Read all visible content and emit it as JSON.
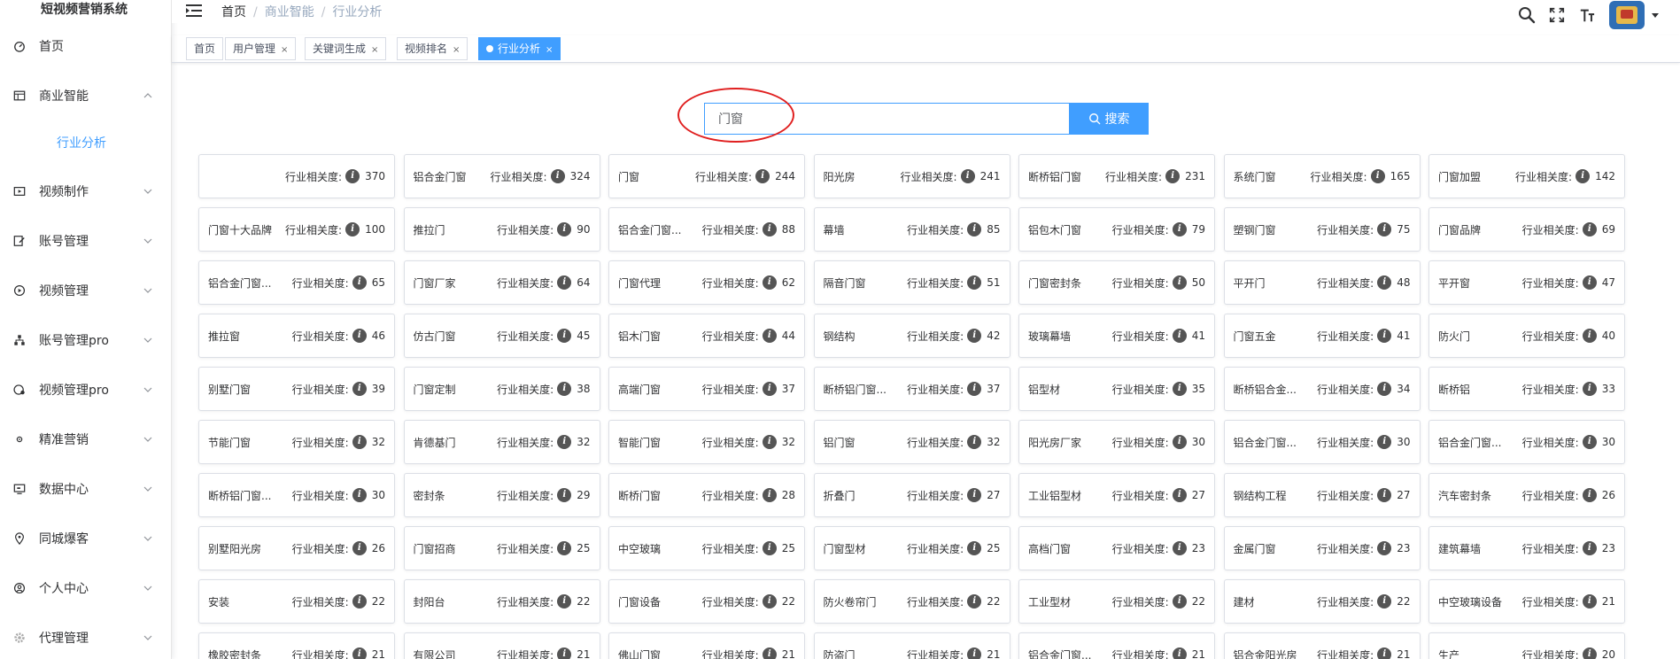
{
  "app": {
    "title": "短视频营销系统"
  },
  "sidebar": {
    "items": [
      {
        "label": "首页",
        "icon": "dashboard-icon",
        "expandable": false
      },
      {
        "label": "商业智能",
        "icon": "table-icon",
        "expandable": true,
        "expanded": true
      },
      {
        "label": "视频制作",
        "icon": "video-icon",
        "expandable": true
      },
      {
        "label": "账号管理",
        "icon": "edit-icon",
        "expandable": true
      },
      {
        "label": "视频管理",
        "icon": "play-icon",
        "expandable": true
      },
      {
        "label": "账号管理pro",
        "icon": "tree-icon",
        "expandable": true
      },
      {
        "label": "视频管理pro",
        "icon": "guide-icon",
        "expandable": true
      },
      {
        "label": "精准营销",
        "icon": "target-icon",
        "expandable": true
      },
      {
        "label": "数据中心",
        "icon": "monitor-icon",
        "expandable": true
      },
      {
        "label": "同城爆客",
        "icon": "location-icon",
        "expandable": true
      },
      {
        "label": "个人中心",
        "icon": "user-icon",
        "expandable": true
      },
      {
        "label": "代理管理",
        "icon": "settings-icon",
        "expandable": true
      }
    ],
    "submenu": {
      "label": "行业分析"
    }
  },
  "breadcrumb": {
    "items": [
      "首页",
      "商业智能",
      "行业分析"
    ]
  },
  "tags": [
    {
      "label": "首页",
      "closable": false,
      "active": false
    },
    {
      "label": "用户管理",
      "closable": true,
      "active": false
    },
    {
      "label": "关键词生成",
      "closable": true,
      "active": false
    },
    {
      "label": "视频排名",
      "closable": true,
      "active": false
    },
    {
      "label": "行业分析",
      "closable": true,
      "active": true
    }
  ],
  "search": {
    "value": "门窗",
    "button_label": "搜索"
  },
  "relevance_label": "行业相关度:",
  "results": [
    {
      "keyword": "",
      "score": 370
    },
    {
      "keyword": "铝合金门窗",
      "score": 324
    },
    {
      "keyword": "门窗",
      "score": 244
    },
    {
      "keyword": "阳光房",
      "score": 241
    },
    {
      "keyword": "断桥铝门窗",
      "score": 231
    },
    {
      "keyword": "系统门窗",
      "score": 165
    },
    {
      "keyword": "门窗加盟",
      "score": 142
    },
    {
      "keyword": "门窗十大品牌",
      "score": 100
    },
    {
      "keyword": "推拉门",
      "score": 90
    },
    {
      "keyword": "铝合金门窗...",
      "score": 88
    },
    {
      "keyword": "幕墙",
      "score": 85
    },
    {
      "keyword": "铝包木门窗",
      "score": 79
    },
    {
      "keyword": "塑钢门窗",
      "score": 75
    },
    {
      "keyword": "门窗品牌",
      "score": 69
    },
    {
      "keyword": "铝合金门窗...",
      "score": 65
    },
    {
      "keyword": "门窗厂家",
      "score": 64
    },
    {
      "keyword": "门窗代理",
      "score": 62
    },
    {
      "keyword": "隔音门窗",
      "score": 51
    },
    {
      "keyword": "门窗密封条",
      "score": 50
    },
    {
      "keyword": "平开门",
      "score": 48
    },
    {
      "keyword": "平开窗",
      "score": 47
    },
    {
      "keyword": "推拉窗",
      "score": 46
    },
    {
      "keyword": "仿古门窗",
      "score": 45
    },
    {
      "keyword": "铝木门窗",
      "score": 44
    },
    {
      "keyword": "钢结构",
      "score": 42
    },
    {
      "keyword": "玻璃幕墙",
      "score": 41
    },
    {
      "keyword": "门窗五金",
      "score": 41
    },
    {
      "keyword": "防火门",
      "score": 40
    },
    {
      "keyword": "别墅门窗",
      "score": 39
    },
    {
      "keyword": "门窗定制",
      "score": 38
    },
    {
      "keyword": "高端门窗",
      "score": 37
    },
    {
      "keyword": "断桥铝门窗...",
      "score": 37
    },
    {
      "keyword": "铝型材",
      "score": 35
    },
    {
      "keyword": "断桥铝合金...",
      "score": 34
    },
    {
      "keyword": "断桥铝",
      "score": 33
    },
    {
      "keyword": "节能门窗",
      "score": 32
    },
    {
      "keyword": "肯德基门",
      "score": 32
    },
    {
      "keyword": "智能门窗",
      "score": 32
    },
    {
      "keyword": "铝门窗",
      "score": 32
    },
    {
      "keyword": "阳光房厂家",
      "score": 30
    },
    {
      "keyword": "铝合金门窗...",
      "score": 30
    },
    {
      "keyword": "铝合金门窗...",
      "score": 30
    },
    {
      "keyword": "断桥铝门窗...",
      "score": 30
    },
    {
      "keyword": "密封条",
      "score": 29
    },
    {
      "keyword": "断桥门窗",
      "score": 28
    },
    {
      "keyword": "折叠门",
      "score": 27
    },
    {
      "keyword": "工业铝型材",
      "score": 27
    },
    {
      "keyword": "钢结构工程",
      "score": 27
    },
    {
      "keyword": "汽车密封条",
      "score": 26
    },
    {
      "keyword": "别墅阳光房",
      "score": 26
    },
    {
      "keyword": "门窗招商",
      "score": 25
    },
    {
      "keyword": "中空玻璃",
      "score": 25
    },
    {
      "keyword": "门窗型材",
      "score": 25
    },
    {
      "keyword": "高档门窗",
      "score": 23
    },
    {
      "keyword": "金属门窗",
      "score": 23
    },
    {
      "keyword": "建筑幕墙",
      "score": 23
    },
    {
      "keyword": "安装",
      "score": 22
    },
    {
      "keyword": "封阳台",
      "score": 22
    },
    {
      "keyword": "门窗设备",
      "score": 22
    },
    {
      "keyword": "防火卷帘门",
      "score": 22
    },
    {
      "keyword": "工业型材",
      "score": 22
    },
    {
      "keyword": "建材",
      "score": 22
    },
    {
      "keyword": "中空玻璃设备",
      "score": 21
    },
    {
      "keyword": "橡胶密封条",
      "score": 21
    },
    {
      "keyword": "有限公司",
      "score": 21
    },
    {
      "keyword": "佛山门窗",
      "score": 21
    },
    {
      "keyword": "防盗门",
      "score": 21
    },
    {
      "keyword": "铝合金门窗...",
      "score": 21
    },
    {
      "keyword": "铝合金阳光房",
      "score": 21
    },
    {
      "keyword": "生产",
      "score": 20
    }
  ]
}
